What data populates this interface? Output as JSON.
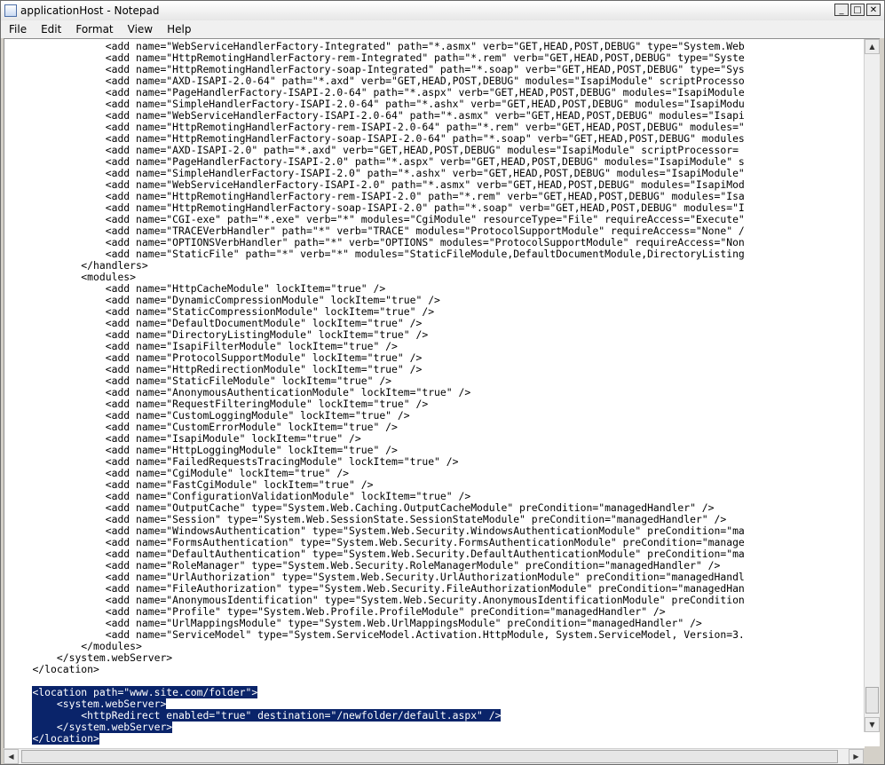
{
  "window": {
    "title": "applicationHost - Notepad",
    "buttons": {
      "minimize": "_",
      "maximize": "□",
      "close": "✕"
    }
  },
  "menu": [
    "File",
    "Edit",
    "Format",
    "View",
    "Help"
  ],
  "editor": {
    "lines": [
      {
        "text": "            <add name=\"WebServiceHandlerFactory-Integrated\" path=\"*.asmx\" verb=\"GET,HEAD,POST,DEBUG\" type=\"System.Web",
        "selected": false
      },
      {
        "text": "            <add name=\"HttpRemotingHandlerFactory-rem-Integrated\" path=\"*.rem\" verb=\"GET,HEAD,POST,DEBUG\" type=\"Syste",
        "selected": false
      },
      {
        "text": "            <add name=\"HttpRemotingHandlerFactory-soap-Integrated\" path=\"*.soap\" verb=\"GET,HEAD,POST,DEBUG\" type=\"Sys",
        "selected": false
      },
      {
        "text": "            <add name=\"AXD-ISAPI-2.0-64\" path=\"*.axd\" verb=\"GET,HEAD,POST,DEBUG\" modules=\"IsapiModule\" scriptProcesso",
        "selected": false
      },
      {
        "text": "            <add name=\"PageHandlerFactory-ISAPI-2.0-64\" path=\"*.aspx\" verb=\"GET,HEAD,POST,DEBUG\" modules=\"IsapiModule",
        "selected": false
      },
      {
        "text": "            <add name=\"SimpleHandlerFactory-ISAPI-2.0-64\" path=\"*.ashx\" verb=\"GET,HEAD,POST,DEBUG\" modules=\"IsapiModu",
        "selected": false
      },
      {
        "text": "            <add name=\"WebServiceHandlerFactory-ISAPI-2.0-64\" path=\"*.asmx\" verb=\"GET,HEAD,POST,DEBUG\" modules=\"Isapi",
        "selected": false
      },
      {
        "text": "            <add name=\"HttpRemotingHandlerFactory-rem-ISAPI-2.0-64\" path=\"*.rem\" verb=\"GET,HEAD,POST,DEBUG\" modules=\"",
        "selected": false
      },
      {
        "text": "            <add name=\"HttpRemotingHandlerFactory-soap-ISAPI-2.0-64\" path=\"*.soap\" verb=\"GET,HEAD,POST,DEBUG\" modules",
        "selected": false
      },
      {
        "text": "            <add name=\"AXD-ISAPI-2.0\" path=\"*.axd\" verb=\"GET,HEAD,POST,DEBUG\" modules=\"IsapiModule\" scriptProcessor=",
        "selected": false
      },
      {
        "text": "            <add name=\"PageHandlerFactory-ISAPI-2.0\" path=\"*.aspx\" verb=\"GET,HEAD,POST,DEBUG\" modules=\"IsapiModule\" s",
        "selected": false
      },
      {
        "text": "            <add name=\"SimpleHandlerFactory-ISAPI-2.0\" path=\"*.ashx\" verb=\"GET,HEAD,POST,DEBUG\" modules=\"IsapiModule\"",
        "selected": false
      },
      {
        "text": "            <add name=\"WebServiceHandlerFactory-ISAPI-2.0\" path=\"*.asmx\" verb=\"GET,HEAD,POST,DEBUG\" modules=\"IsapiMod",
        "selected": false
      },
      {
        "text": "            <add name=\"HttpRemotingHandlerFactory-rem-ISAPI-2.0\" path=\"*.rem\" verb=\"GET,HEAD,POST,DEBUG\" modules=\"Isa",
        "selected": false
      },
      {
        "text": "            <add name=\"HttpRemotingHandlerFactory-soap-ISAPI-2.0\" path=\"*.soap\" verb=\"GET,HEAD,POST,DEBUG\" modules=\"I",
        "selected": false
      },
      {
        "text": "            <add name=\"CGI-exe\" path=\"*.exe\" verb=\"*\" modules=\"CgiModule\" resourceType=\"File\" requireAccess=\"Execute\"",
        "selected": false
      },
      {
        "text": "            <add name=\"TRACEVerbHandler\" path=\"*\" verb=\"TRACE\" modules=\"ProtocolSupportModule\" requireAccess=\"None\" /",
        "selected": false
      },
      {
        "text": "            <add name=\"OPTIONSVerbHandler\" path=\"*\" verb=\"OPTIONS\" modules=\"ProtocolSupportModule\" requireAccess=\"Non",
        "selected": false
      },
      {
        "text": "            <add name=\"StaticFile\" path=\"*\" verb=\"*\" modules=\"StaticFileModule,DefaultDocumentModule,DirectoryListing",
        "selected": false
      },
      {
        "text": "        </handlers>",
        "selected": false
      },
      {
        "text": "        <modules>",
        "selected": false
      },
      {
        "text": "            <add name=\"HttpCacheModule\" lockItem=\"true\" />",
        "selected": false
      },
      {
        "text": "            <add name=\"DynamicCompressionModule\" lockItem=\"true\" />",
        "selected": false
      },
      {
        "text": "            <add name=\"StaticCompressionModule\" lockItem=\"true\" />",
        "selected": false
      },
      {
        "text": "            <add name=\"DefaultDocumentModule\" lockItem=\"true\" />",
        "selected": false
      },
      {
        "text": "            <add name=\"DirectoryListingModule\" lockItem=\"true\" />",
        "selected": false
      },
      {
        "text": "            <add name=\"IsapiFilterModule\" lockItem=\"true\" />",
        "selected": false
      },
      {
        "text": "            <add name=\"ProtocolSupportModule\" lockItem=\"true\" />",
        "selected": false
      },
      {
        "text": "            <add name=\"HttpRedirectionModule\" lockItem=\"true\" />",
        "selected": false
      },
      {
        "text": "            <add name=\"StaticFileModule\" lockItem=\"true\" />",
        "selected": false
      },
      {
        "text": "            <add name=\"AnonymousAuthenticationModule\" lockItem=\"true\" />",
        "selected": false
      },
      {
        "text": "            <add name=\"RequestFilteringModule\" lockItem=\"true\" />",
        "selected": false
      },
      {
        "text": "            <add name=\"CustomLoggingModule\" lockItem=\"true\" />",
        "selected": false
      },
      {
        "text": "            <add name=\"CustomErrorModule\" lockItem=\"true\" />",
        "selected": false
      },
      {
        "text": "            <add name=\"IsapiModule\" lockItem=\"true\" />",
        "selected": false
      },
      {
        "text": "            <add name=\"HttpLoggingModule\" lockItem=\"true\" />",
        "selected": false
      },
      {
        "text": "            <add name=\"FailedRequestsTracingModule\" lockItem=\"true\" />",
        "selected": false
      },
      {
        "text": "            <add name=\"CgiModule\" lockItem=\"true\" />",
        "selected": false
      },
      {
        "text": "            <add name=\"FastCgiModule\" lockItem=\"true\" />",
        "selected": false
      },
      {
        "text": "            <add name=\"ConfigurationValidationModule\" lockItem=\"true\" />",
        "selected": false
      },
      {
        "text": "            <add name=\"OutputCache\" type=\"System.Web.Caching.OutputCacheModule\" preCondition=\"managedHandler\" />",
        "selected": false
      },
      {
        "text": "            <add name=\"Session\" type=\"System.Web.SessionState.SessionStateModule\" preCondition=\"managedHandler\" />",
        "selected": false
      },
      {
        "text": "            <add name=\"WindowsAuthentication\" type=\"System.Web.Security.WindowsAuthenticationModule\" preCondition=\"ma",
        "selected": false
      },
      {
        "text": "            <add name=\"FormsAuthentication\" type=\"System.Web.Security.FormsAuthenticationModule\" preCondition=\"manage",
        "selected": false
      },
      {
        "text": "            <add name=\"DefaultAuthentication\" type=\"System.Web.Security.DefaultAuthenticationModule\" preCondition=\"ma",
        "selected": false
      },
      {
        "text": "            <add name=\"RoleManager\" type=\"System.Web.Security.RoleManagerModule\" preCondition=\"managedHandler\" />",
        "selected": false
      },
      {
        "text": "            <add name=\"UrlAuthorization\" type=\"System.Web.Security.UrlAuthorizationModule\" preCondition=\"managedHandl",
        "selected": false
      },
      {
        "text": "            <add name=\"FileAuthorization\" type=\"System.Web.Security.FileAuthorizationModule\" preCondition=\"managedHan",
        "selected": false
      },
      {
        "text": "            <add name=\"AnonymousIdentification\" type=\"System.Web.Security.AnonymousIdentificationModule\" preCondition",
        "selected": false
      },
      {
        "text": "            <add name=\"Profile\" type=\"System.Web.Profile.ProfileModule\" preCondition=\"managedHandler\" />",
        "selected": false
      },
      {
        "text": "            <add name=\"UrlMappingsModule\" type=\"System.Web.UrlMappingsModule\" preCondition=\"managedHandler\" />",
        "selected": false
      },
      {
        "text": "            <add name=\"ServiceModel\" type=\"System.ServiceModel.Activation.HttpModule, System.ServiceModel, Version=3.",
        "selected": false
      },
      {
        "text": "        </modules>",
        "selected": false
      },
      {
        "text": "    </system.webServer>",
        "selected": false
      },
      {
        "text": "</location>",
        "selected": false
      },
      {
        "text": "",
        "selected": false
      },
      {
        "text": "<location path=\"www.site.com/folder\">",
        "selected": true
      },
      {
        "text": "    <system.webServer>",
        "selected": true
      },
      {
        "text": "        <httpRedirect enabled=\"true\" destination=\"/newfolder/default.aspx\" />",
        "selected": true
      },
      {
        "text": "    </system.webServer>",
        "selected": true
      },
      {
        "text": "</location>",
        "selected": true
      }
    ],
    "indent_prefix": "    "
  },
  "scrollbar": {
    "up_arrow": "▲",
    "down_arrow": "▼",
    "left_arrow": "◀",
    "right_arrow": "▶"
  }
}
